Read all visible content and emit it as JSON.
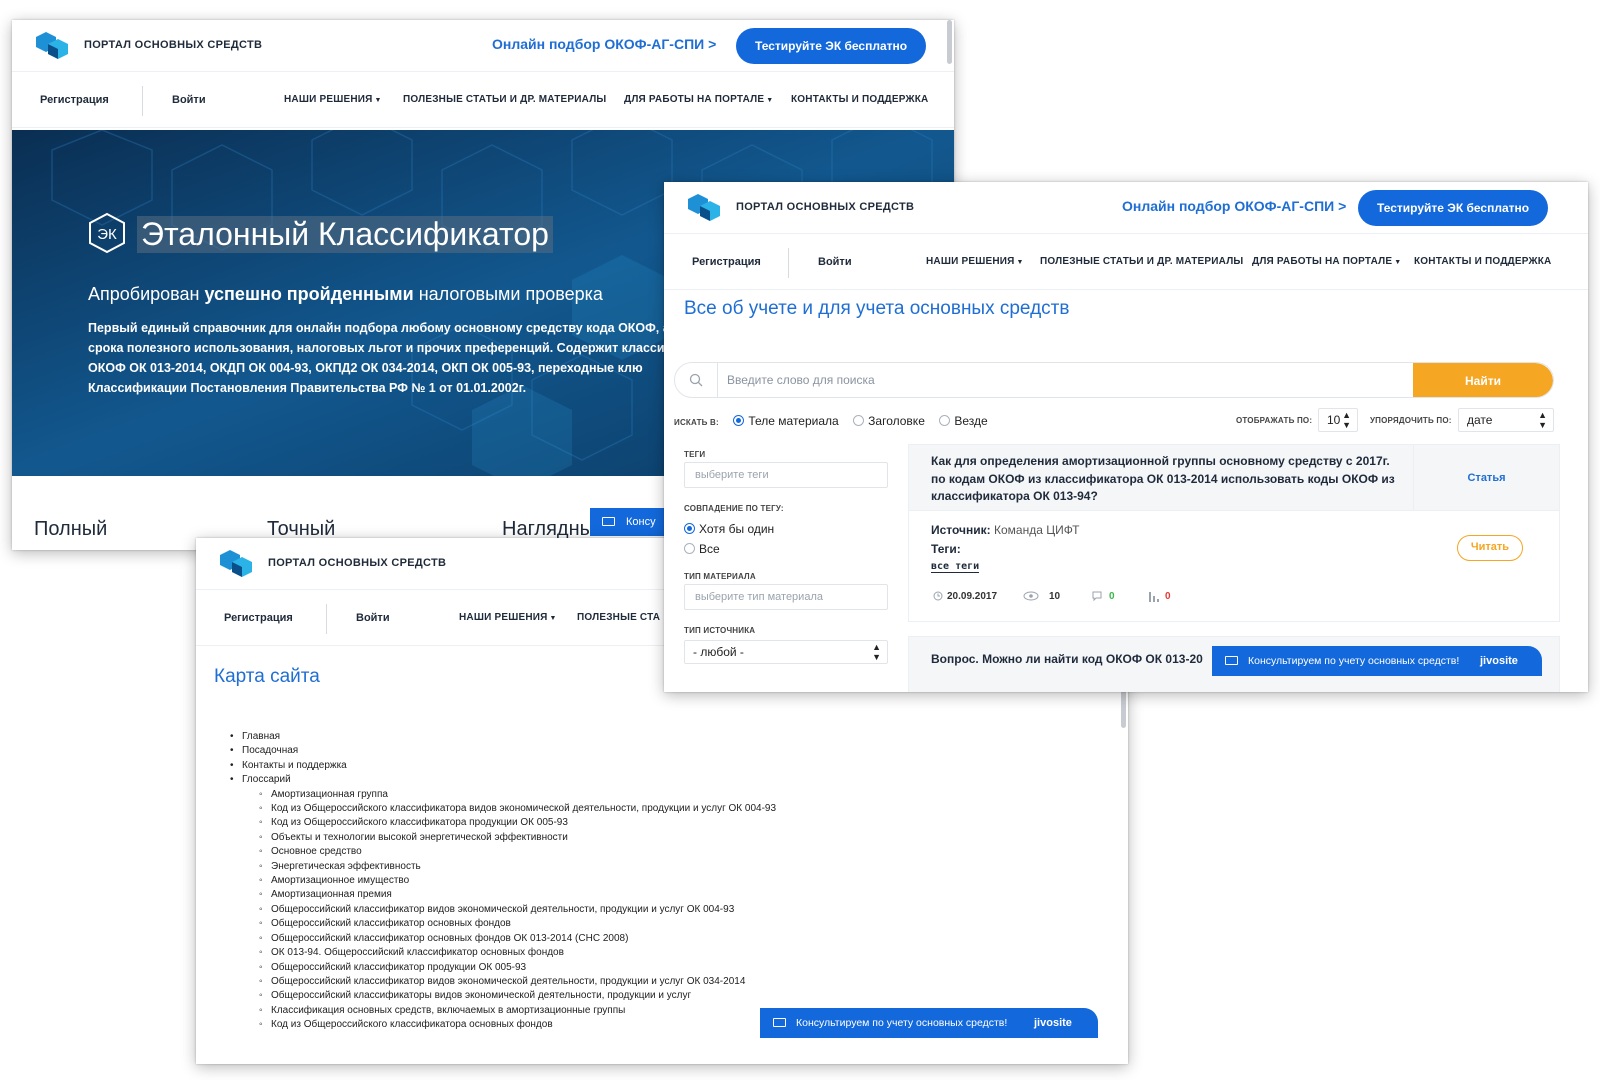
{
  "brand": {
    "name": "ПОРТАЛ ОСНОВНЫХ СРЕДСТВ",
    "okof_link": "Онлайн подбор ОКОФ-АГ-СПИ >",
    "cta": "Тестируйте ЭК бесплатно"
  },
  "nav": {
    "register": "Регистрация",
    "login": "Войти",
    "solutions": "НАШИ РЕШЕНИЯ",
    "articles": "ПОЛЕЗНЫЕ СТАТЬИ И ДР. МАТЕРИАЛЫ",
    "portal_work": "ДЛЯ РАБОТЫ НА ПОРТАЛЕ",
    "contacts": "КОНТАКТЫ И ПОДДЕРЖКА",
    "articles_cut": "ПОЛЕЗНЫЕ СТА"
  },
  "hero": {
    "badge": "ЭК",
    "title": "Эталонный Классификатор",
    "subtitle_pre": "Апробирован ",
    "subtitle_bold": "успешно пройденными",
    "subtitle_post": " налоговыми проверка",
    "lines": [
      "Первый единый справочник для онлайн подбора любому основному средству кода ОКОФ, амор",
      "срока полезного использования, налоговых льгот и прочих преференций. Содержит классифика",
      "ОКОФ ОК 013-2014, ОКДП ОК 004-93, ОКПД2 ОК 034-2014, ОКП ОК 005-93, переходные клю",
      "Классификации Постановления Правительства РФ № 1 от 01.01.2002г."
    ],
    "features": [
      "Полный",
      "Точный",
      "Наглядны"
    ],
    "consult_stub": "Консу"
  },
  "sitemap": {
    "title": "Карта сайта",
    "top_items": [
      "Главная",
      "Посадочная",
      "Контакты и поддержка",
      "Глоссарий"
    ],
    "glossary": [
      "Амортизационная группа",
      "Код из Общероссийского классификатора видов экономической деятельности, продукции и услуг ОК 004-93",
      "Код из Общероссийского классификатора продукции ОК 005-93",
      "Объекты и технологии высокой энергетической эффективности",
      "Основное средство",
      "Энергетическая эффективность",
      "Амортизационное имущество",
      "Амортизационная премия",
      "Общероссийский классификатор видов экономической деятельности, продукции и услуг ОК 004-93",
      "Общероссийский классификатор основных фондов",
      "Общероссийский классификатор основных фондов ОК 013-2014 (СНС 2008)",
      "ОК 013-94. Общероссийский классификатор основных фондов",
      "Общероссийский классификатор продукции ОК 005-93",
      "Общероссийский классификатор видов экономической деятельности, продукции и услуг ОК 034-2014",
      "Общероссийский классификаторы видов экономической деятельности, продукции и услуг",
      "Классификация основных средств, включаемых в амортизационные группы",
      "Код из Общероссийского классификатора основных фондов"
    ]
  },
  "jivo": {
    "message": "Консультируем по учету основных средств!",
    "brand": "jivosite"
  },
  "search": {
    "title": "Все об учете и для учета основных средств",
    "placeholder": "Введите слово для поиска",
    "button": "Найти",
    "search_in_label": "ИСКАТЬ В:",
    "search_in": [
      {
        "label": "Теле материала",
        "selected": true
      },
      {
        "label": "Заголовке",
        "selected": false
      },
      {
        "label": "Везде",
        "selected": false
      }
    ],
    "display_label": "ОТОБРАЖАТЬ ПО:",
    "display_value": "10",
    "sort_label": "УПОРЯДОЧИТЬ ПО:",
    "sort_value": "дате"
  },
  "filters": {
    "tags_label": "ТЕГИ",
    "tags_placeholder": "выберите теги",
    "match_label": "СОВПАДЕНИЕ ПО ТЕГУ:",
    "match_options": [
      {
        "label": "Хотя бы один",
        "selected": true
      },
      {
        "label": "Все",
        "selected": false
      }
    ],
    "material_type_label": "ТИП МАТЕРИАЛА",
    "material_type_placeholder": "выберите тип материала",
    "source_type_label": "ТИП ИСТОЧНИКА",
    "source_type_value": "- любой -"
  },
  "results": [
    {
      "title": "Как для определения амортизационной группы основному средству с 2017г. по кодам ОКОФ из классификатора ОК 013-2014 использовать коды ОКОФ из классификатора ОК 013-94?",
      "kind": "Статья",
      "source_label": "Источник:",
      "source": "Команда ЦИФТ",
      "tags_label": "Теги:",
      "all_tags": "все теги",
      "read": "Читать",
      "date": "20.09.2017",
      "views": "10",
      "comments": "0",
      "rating": "0"
    },
    {
      "title": "Вопрос. Можно ли найти код ОКОФ ОК 013-20"
    }
  ],
  "colors": {
    "accent": "#1369dc",
    "link": "#1f6ed4",
    "orange": "#f5a623",
    "hero_bg": "#0d3e68"
  }
}
